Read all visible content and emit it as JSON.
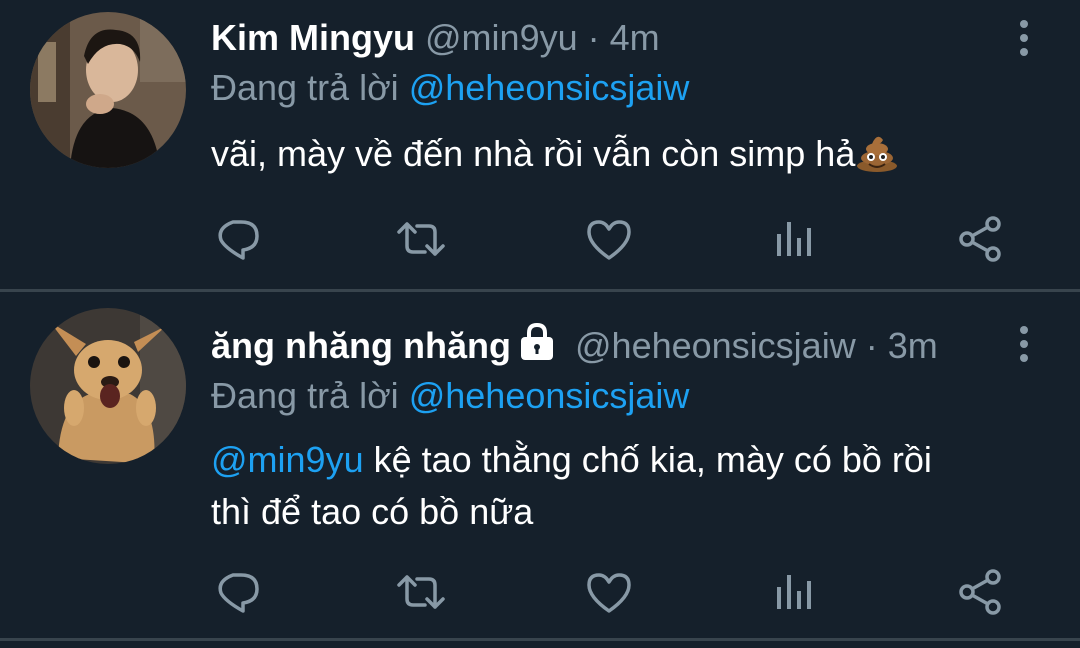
{
  "colors": {
    "background": "#15202b",
    "divider": "#38444d",
    "muted": "#8899a6",
    "accent": "#1da1f2",
    "text": "#ffffff"
  },
  "tweets": [
    {
      "display_name": "Kim Mingyu",
      "handle": "@min9yu",
      "separator": "·",
      "time": "4m",
      "replying_label": "Đang trả lời",
      "replying_to": "@heheonsicsjaiw",
      "text": "vãi, mày về đến nhà rồi vẫn còn simp hả",
      "emoji": "pile-of-poo-icon",
      "locked": false
    },
    {
      "display_name": "ăng nhăng nhăng",
      "handle": "@heheonsicsjaiw",
      "separator": "·",
      "time": "3m",
      "replying_label": "Đang trả lời",
      "replying_to": "@heheonsicsjaiw",
      "mention": "@min9yu",
      "text_line1": " kệ tao thằng chố kia, mày có bồ rồi",
      "text_line2": "thì để tao có bồ nữa",
      "locked": true
    }
  ],
  "actions": [
    "reply-icon",
    "retweet-icon",
    "like-icon",
    "analytics-icon",
    "share-icon"
  ]
}
